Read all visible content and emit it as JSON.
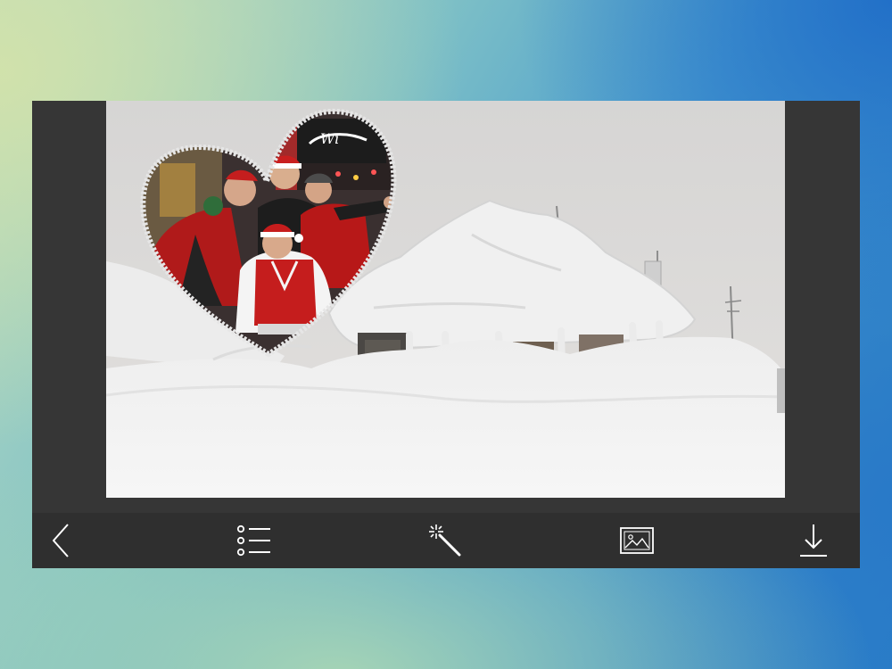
{
  "editor": {
    "photo_subject": "Friends in Santa hats inside a heart-shaped frame over a snow-covered cabin",
    "sign_text": "Wi"
  },
  "toolbar": {
    "items": [
      {
        "icon": "chevron-left-icon",
        "label": "Back"
      },
      {
        "icon": "list-icon",
        "label": "Frames"
      },
      {
        "icon": "magic-wand-icon",
        "label": "Effects"
      },
      {
        "icon": "image-icon",
        "label": "Gallery"
      },
      {
        "icon": "download-icon",
        "label": "Save"
      }
    ]
  },
  "colors": {
    "panel": "#363636",
    "toolbar": "#2f2f2f",
    "icon": "#ffffff",
    "heart_border": "#e6e6e6"
  }
}
